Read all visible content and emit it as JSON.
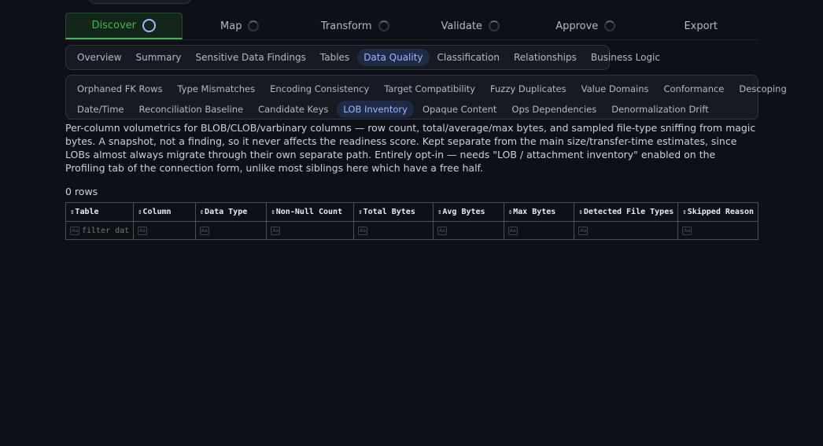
{
  "steps": [
    {
      "label": "Discover"
    },
    {
      "label": "Map"
    },
    {
      "label": "Transform"
    },
    {
      "label": "Validate"
    },
    {
      "label": "Approve"
    },
    {
      "label": "Export"
    }
  ],
  "subtabs": [
    "Overview",
    "Summary",
    "Sensitive Data Findings",
    "Tables",
    "Data Quality",
    "Classification",
    "Relationships",
    "Business Logic"
  ],
  "subtabs_active": "Data Quality",
  "inner_tabs_row1": [
    "Orphaned FK Rows",
    "Type Mismatches",
    "Encoding Consistency",
    "Target Compatibility",
    "Fuzzy Duplicates",
    "Value Domains",
    "Conformance",
    "Descoping"
  ],
  "inner_tabs_row2": [
    "Date/Time",
    "Reconciliation Baseline",
    "Candidate Keys",
    "LOB Inventory",
    "Opaque Content",
    "Ops Dependencies",
    "Denormalization Drift"
  ],
  "inner_active": "LOB Inventory",
  "description": "Per-column volumetrics for BLOB/CLOB/varbinary columns — row count, total/average/max bytes, and sampled file-type sniffing from magic bytes. A snapshot, not a finding, so it never affects the readiness score. Kept separate from the main size/transfer-time estimates, since LOBs almost always migrate through their own separate path. Entirely opt-in — needs \"LOB / attachment inventory\" enabled on the Profiling tab of the connection form, unlike most siblings here which have a free half.",
  "row_count": "0 rows",
  "table": {
    "columns": [
      "Table",
      "Column",
      "Data Type",
      "Non-Null Count",
      "Total Bytes",
      "Avg Bytes",
      "Max Bytes",
      "Detected File Types",
      "Skipped Reason"
    ],
    "filter_placeholder": "filter dat",
    "filter_icon_text": "Aa"
  }
}
